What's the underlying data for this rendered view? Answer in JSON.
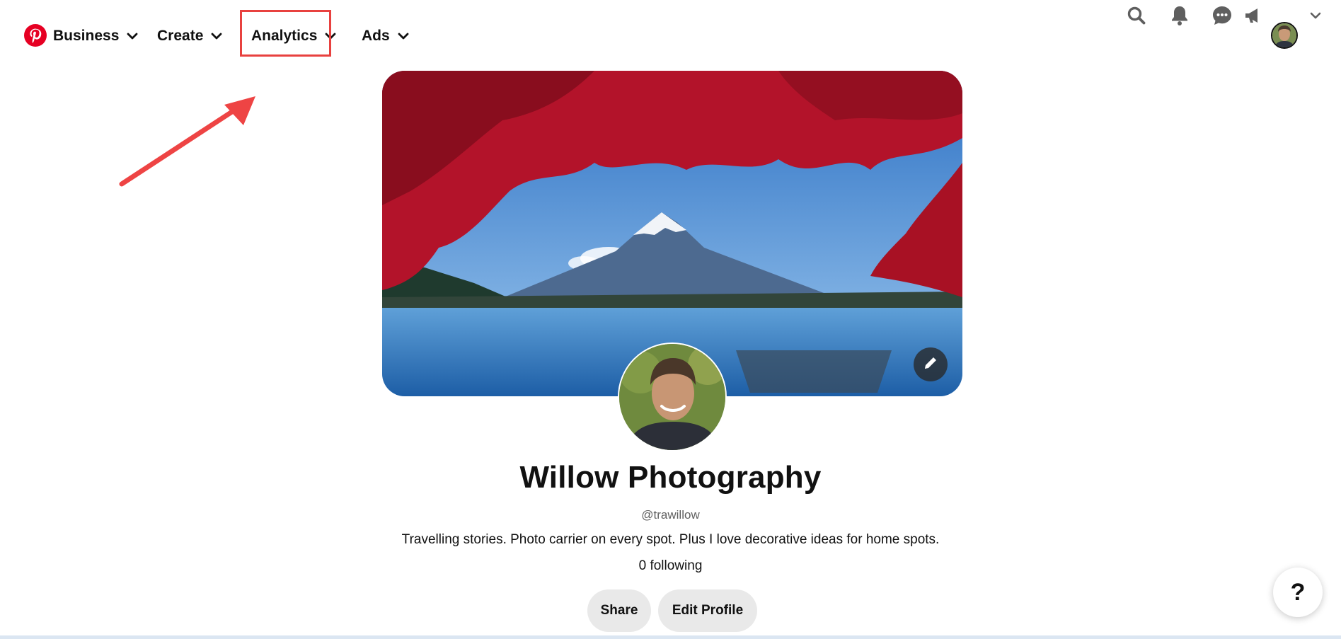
{
  "nav": {
    "business_label": "Business",
    "create_label": "Create",
    "analytics_label": "Analytics",
    "ads_label": "Ads"
  },
  "icons": {
    "logo": "pinterest-logo",
    "search": "search-icon",
    "notifications": "bell-icon",
    "messages": "chat-icon",
    "updates": "megaphone-icon",
    "account_menu": "chevron-down-icon"
  },
  "colors": {
    "brand_red": "#e60023",
    "highlight": "#e8413f",
    "button_bg": "#e9e9e9"
  },
  "profile": {
    "name": "Willow Photography",
    "handle": "@trawillow",
    "bio": "Travelling stories. Photo carrier on every spot. Plus I love decorative ideas for home spots.",
    "following": "0 following"
  },
  "actions": {
    "share_label": "Share",
    "edit_profile_label": "Edit Profile"
  },
  "help": {
    "label": "?"
  }
}
